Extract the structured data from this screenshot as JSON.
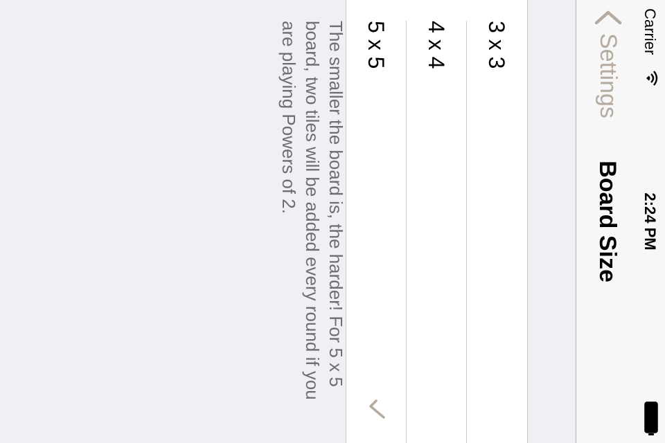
{
  "status_bar": {
    "carrier": "Carrier",
    "time": "2:24 PM",
    "icons": [
      "wifi-icon",
      "battery-icon"
    ]
  },
  "nav": {
    "back_label": "Settings",
    "title": "Board Size",
    "icon": "chevron-left-icon"
  },
  "options": [
    {
      "label": "3 x 3",
      "selected": false
    },
    {
      "label": "4 x 4",
      "selected": false
    },
    {
      "label": "5 x 5",
      "selected": true
    }
  ],
  "footer": {
    "text": "The smaller the board is, the harder! For 5 x 5 board, two tiles will be added every round if you are playing Powers of 2."
  },
  "colors": {
    "accent": "#b5aba0",
    "background": "#efeff4",
    "cell": "#ffffff",
    "footer_text": "#6d6d72"
  }
}
